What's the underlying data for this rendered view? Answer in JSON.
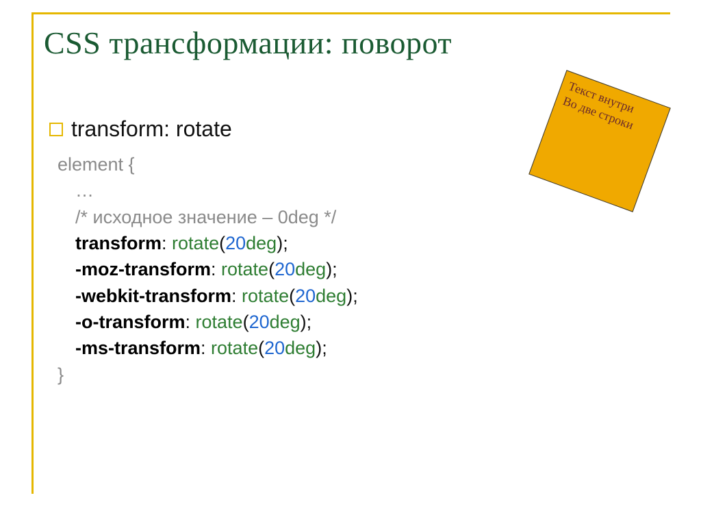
{
  "title": "CSS трансформации: поворот",
  "bullet": "transform: rotate",
  "sticky": {
    "line1": "Текст внутри",
    "line2": "Во две строки"
  },
  "code": {
    "sel": "element {",
    "ell": "…",
    "comment": "/* исходное значение – 0deg */",
    "rules": [
      {
        "prop": "transform",
        "fn": "rotate",
        "num": "20",
        "unit": "deg"
      },
      {
        "prop": "-moz-transform",
        "fn": "rotate",
        "num": "20",
        "unit": "deg"
      },
      {
        "prop": "-webkit-transform",
        "fn": "rotate",
        "num": "20",
        "unit": "deg"
      },
      {
        "prop": "-o-transform",
        "fn": "rotate",
        "num": "20",
        "unit": "deg"
      },
      {
        "prop": "-ms-transform",
        "fn": "rotate",
        "num": "20",
        "unit": "deg"
      }
    ],
    "close": "}"
  }
}
